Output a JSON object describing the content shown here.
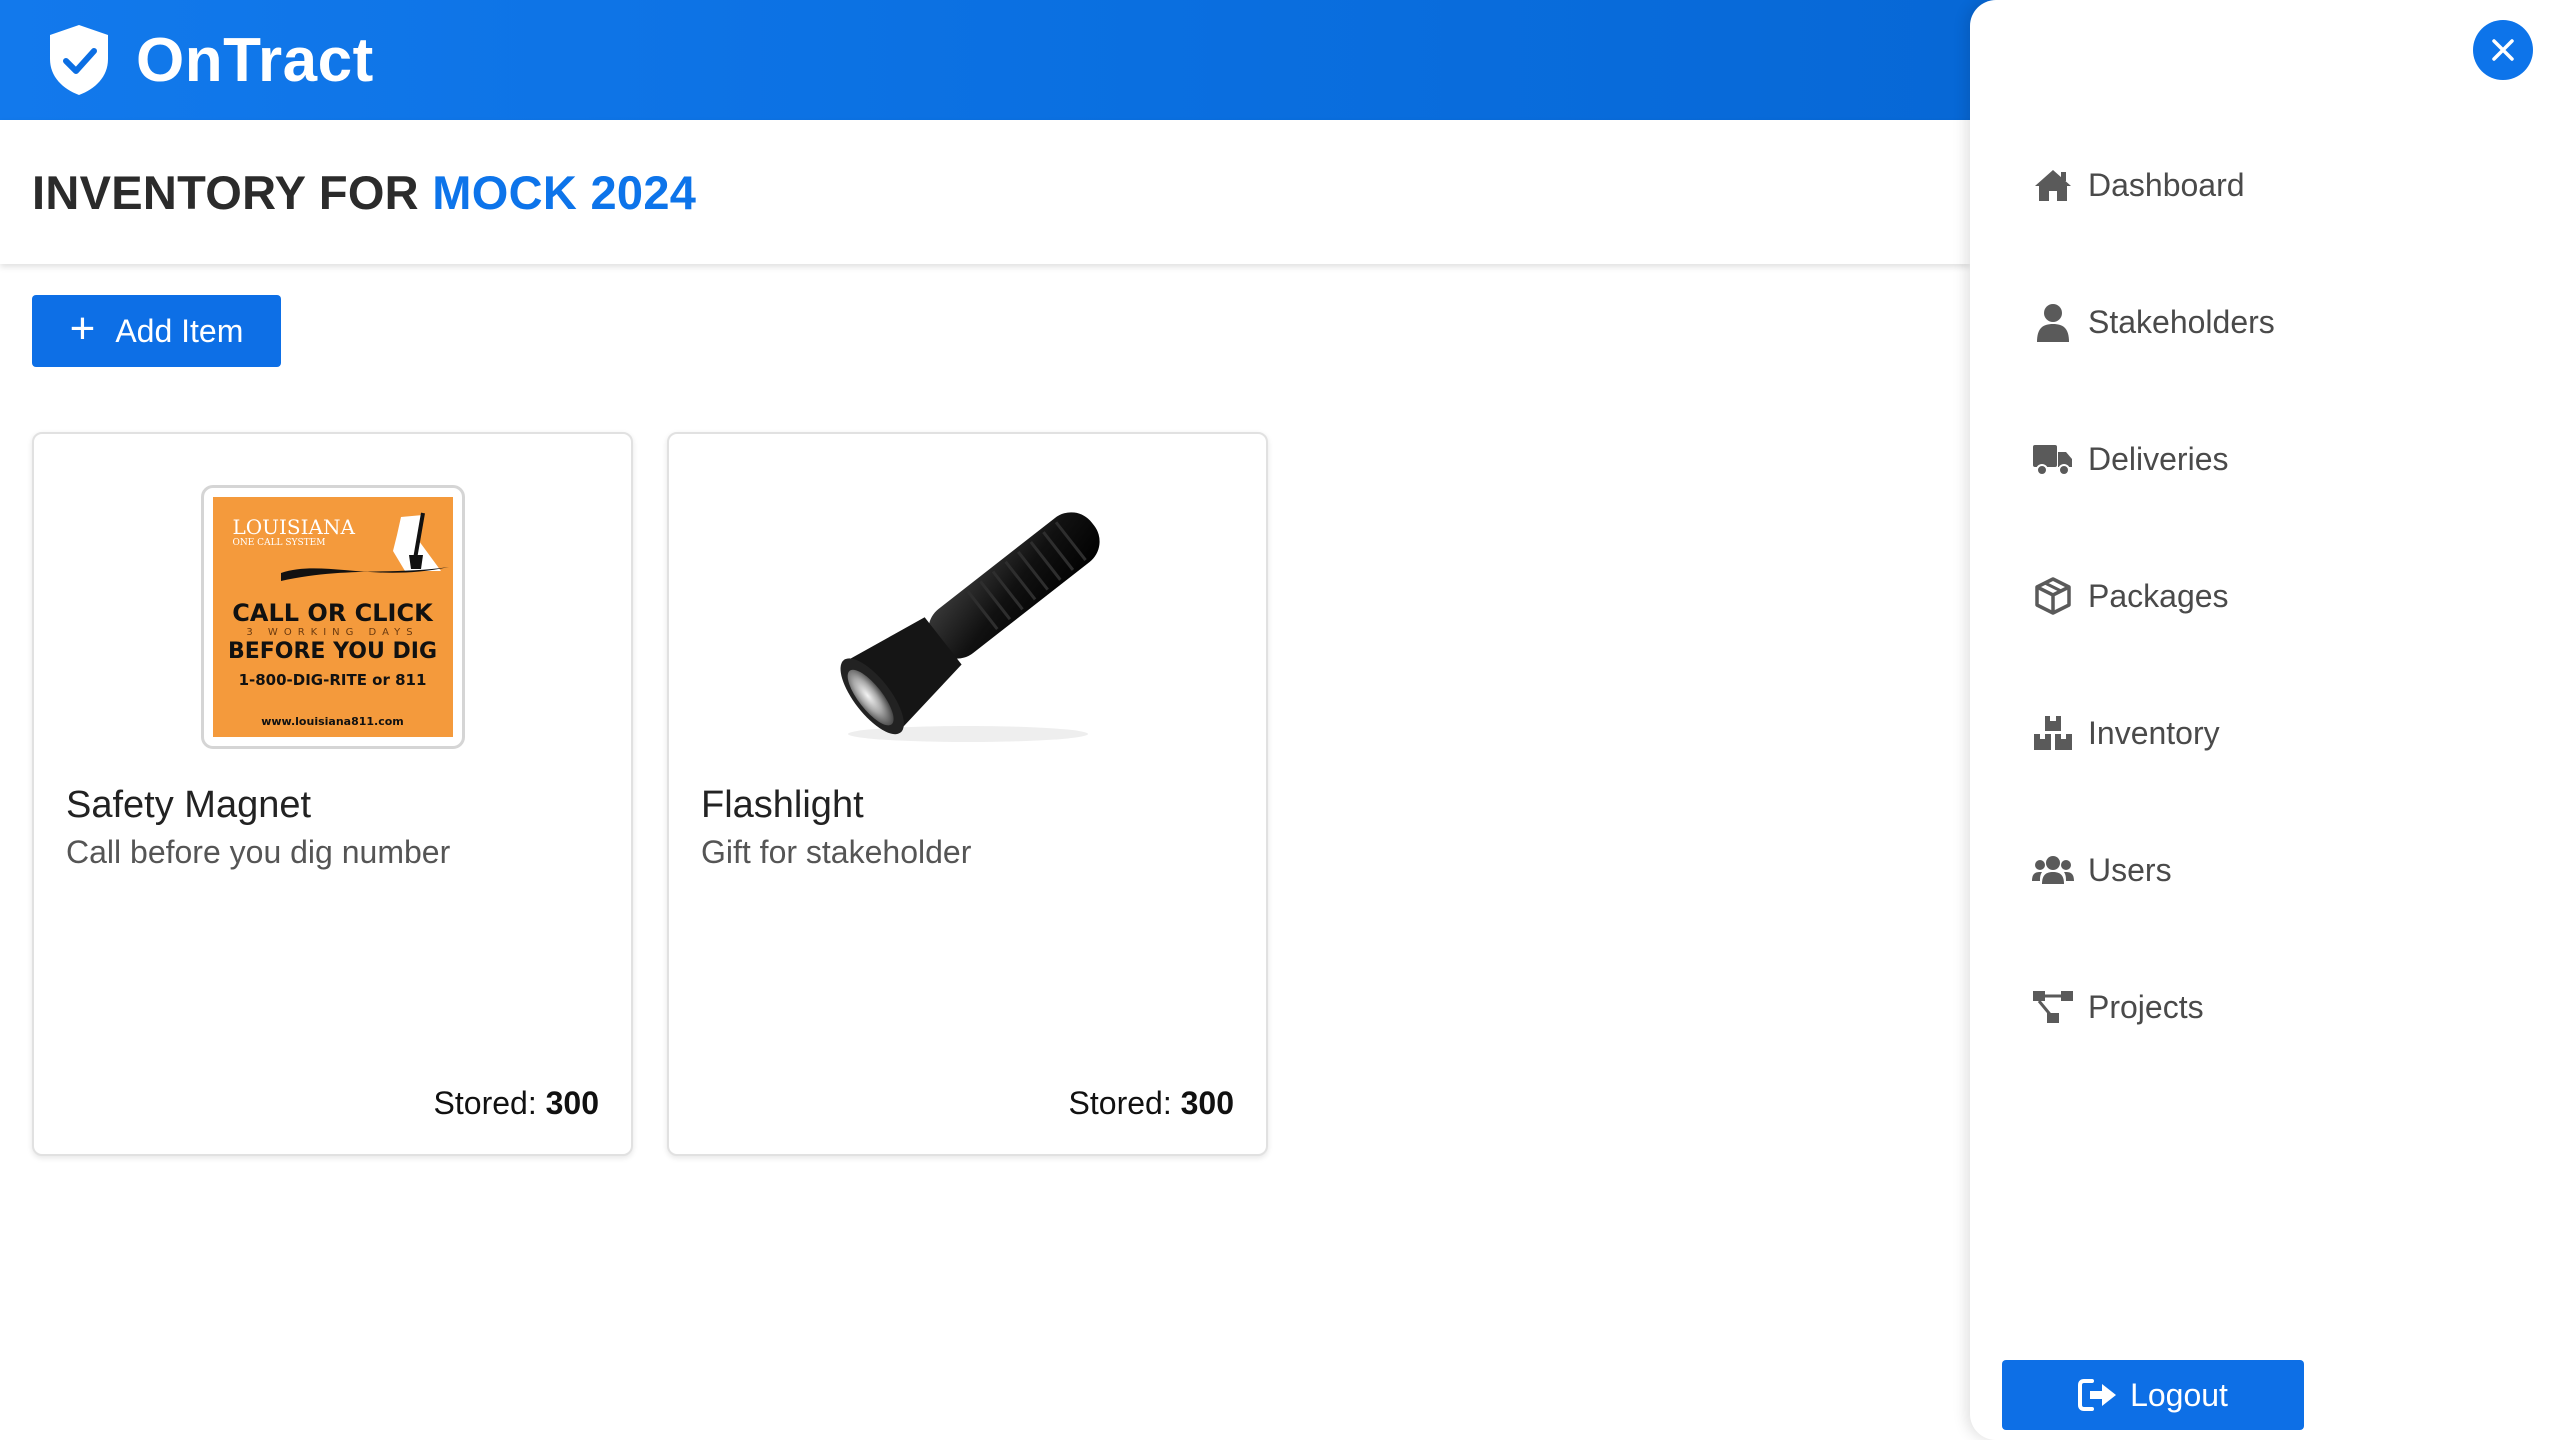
{
  "header": {
    "brand_name": "OnTract",
    "brand_icon": "shield-check-icon"
  },
  "page": {
    "title_prefix": "INVENTORY FOR",
    "title_project": "MOCK 2024"
  },
  "toolbar": {
    "add_item_label": "Add Item",
    "add_item_icon": "plus-icon"
  },
  "inventory": {
    "items": [
      {
        "name": "Safety Magnet",
        "description": "Call before you dig number",
        "stored_label": "Stored:",
        "stored_value": "300",
        "image": {
          "kind": "magnet",
          "line1": "LOUISIANA",
          "line2": "ONE CALL SYSTEM",
          "line3": "CALL OR CLICK",
          "line4": "3 WORKING DAYS",
          "line5": "BEFORE YOU DIG",
          "line6": "1-800-DIG-RITE or 811",
          "line7": "www.louisiana811.com"
        }
      },
      {
        "name": "Flashlight",
        "description": "Gift for stakeholder",
        "stored_label": "Stored:",
        "stored_value": "300",
        "image": {
          "kind": "flashlight"
        }
      }
    ]
  },
  "drawer": {
    "close_icon": "close-icon",
    "nav": [
      {
        "label": "Dashboard",
        "icon": "home-icon"
      },
      {
        "label": "Stakeholders",
        "icon": "user-icon"
      },
      {
        "label": "Deliveries",
        "icon": "truck-icon"
      },
      {
        "label": "Packages",
        "icon": "box-icon"
      },
      {
        "label": "Inventory",
        "icon": "boxes-icon"
      },
      {
        "label": "Users",
        "icon": "users-icon"
      },
      {
        "label": "Projects",
        "icon": "project-diagram-icon"
      }
    ],
    "logout_label": "Logout",
    "logout_icon": "sign-out-icon"
  },
  "colors": {
    "primary": "#0d6fe6",
    "header_gradient_start": "#1279ec",
    "header_gradient_end": "#0563cf",
    "title_accent": "#0d74ea",
    "nav_icon": "#5a5a5a",
    "magnet_orange": "#f49a3c"
  }
}
